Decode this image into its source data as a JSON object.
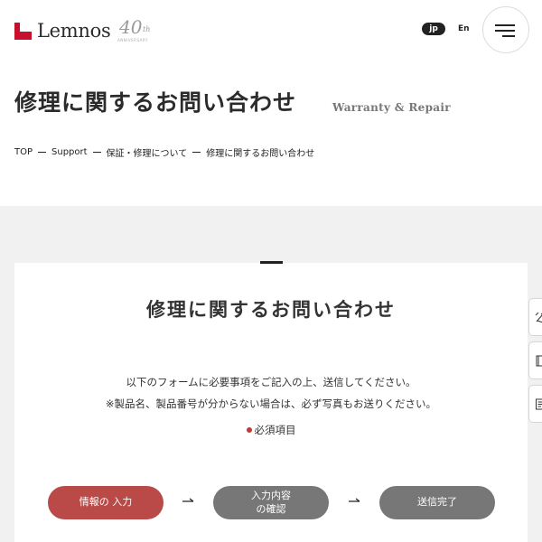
{
  "brand": {
    "name": "Lemnos",
    "anniversary_number": "40",
    "anniversary_suffix": "th",
    "anniversary_label": "ANNIVERSARY",
    "brand_color": "#c8102e"
  },
  "header": {
    "lang_jp": "jp",
    "lang_en": "En",
    "menu_icon": "hamburger-menu-icon"
  },
  "page": {
    "title": "修理に関するお問い合わせ",
    "subtitle": "Warranty & Repair"
  },
  "breadcrumb": [
    "TOP",
    "Support",
    "保証・修理について",
    "修理に関するお問い合わせ"
  ],
  "form": {
    "title": "修理に関するお問い合わせ",
    "description_line1": "以下のフォームに必要事項をご記入の上、送信してください。",
    "description_line2": "※製品名、製品番号が分からない場合は、必ず写真もお送りください。",
    "required_label": "必須項目",
    "required_color": "#c0393b"
  },
  "steps": [
    {
      "line1": "情報の 入力",
      "line2": "",
      "active": true,
      "color": "#b94a48"
    },
    {
      "line1": "入力内容",
      "line2": "の確認",
      "active": false,
      "color": "#777777"
    },
    {
      "line1": "送信完了",
      "line2": "",
      "active": false,
      "color": "#777777"
    }
  ],
  "side_tabs": [
    "tools-icon",
    "catalog-icon",
    "document-icon"
  ]
}
